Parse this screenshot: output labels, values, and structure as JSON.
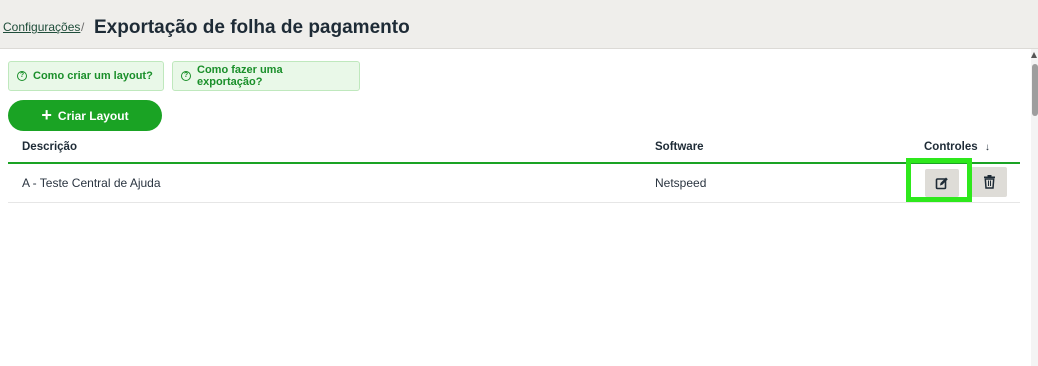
{
  "breadcrumb": {
    "parent": "Configurações",
    "separator": "/"
  },
  "page": {
    "title": "Exportação de folha de pagamento"
  },
  "help": {
    "layout": "Como criar um layout?",
    "export": "Como fazer uma exportação?",
    "icon": "question-circle-icon"
  },
  "actions": {
    "create_layout": "Criar Layout"
  },
  "table": {
    "columns": {
      "description": "Descrição",
      "software": "Software",
      "controls": "Controles",
      "sort_indicator": "↓"
    },
    "rows": [
      {
        "description": "A - Teste Central de Ajuda",
        "software": "Netspeed"
      }
    ]
  },
  "colors": {
    "primary": "#1aa324",
    "highlight": "#2ee81c"
  }
}
